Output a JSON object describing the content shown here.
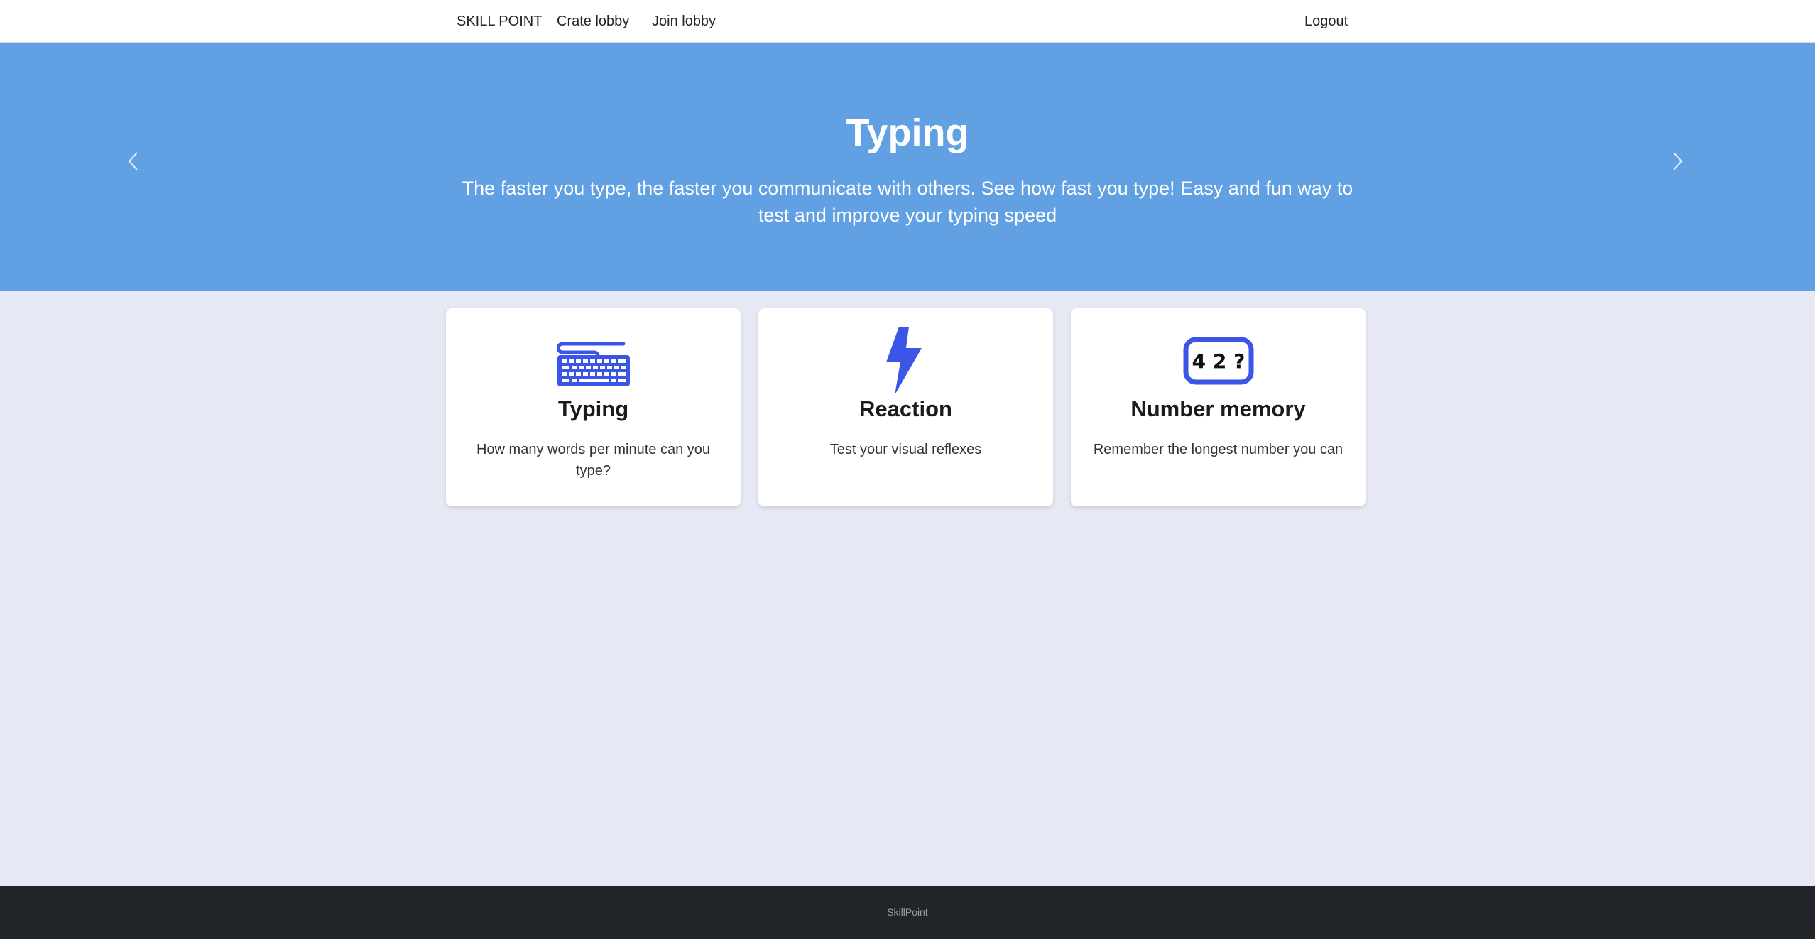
{
  "navbar": {
    "brand": "SKILL POINT",
    "links": {
      "create_lobby": "Crate lobby",
      "join_lobby": "Join lobby",
      "logout": "Logout"
    }
  },
  "hero": {
    "title": "Typing",
    "description": "The faster you type, the faster you communicate with others. See how fast you type! Easy and fun way to test and improve your typing speed",
    "prev_icon": "chevron-left-icon",
    "next_icon": "chevron-right-icon"
  },
  "cards": [
    {
      "icon": "keyboard-icon",
      "title": "Typing",
      "text": "How many words per minute can you type?"
    },
    {
      "icon": "lightning-icon",
      "title": "Reaction",
      "text": "Test your visual reflexes"
    },
    {
      "icon": "number-memory-icon",
      "icon_text": "4 2 ?",
      "title": "Number memory",
      "text": "Remember the longest number you can"
    }
  ],
  "footer": {
    "text": "SkillPoint"
  },
  "colors": {
    "hero_bg": "#61a0e2",
    "icon_accent": "#3b55e6",
    "page_bg": "#e6e8f4",
    "footer_bg": "#212429"
  }
}
